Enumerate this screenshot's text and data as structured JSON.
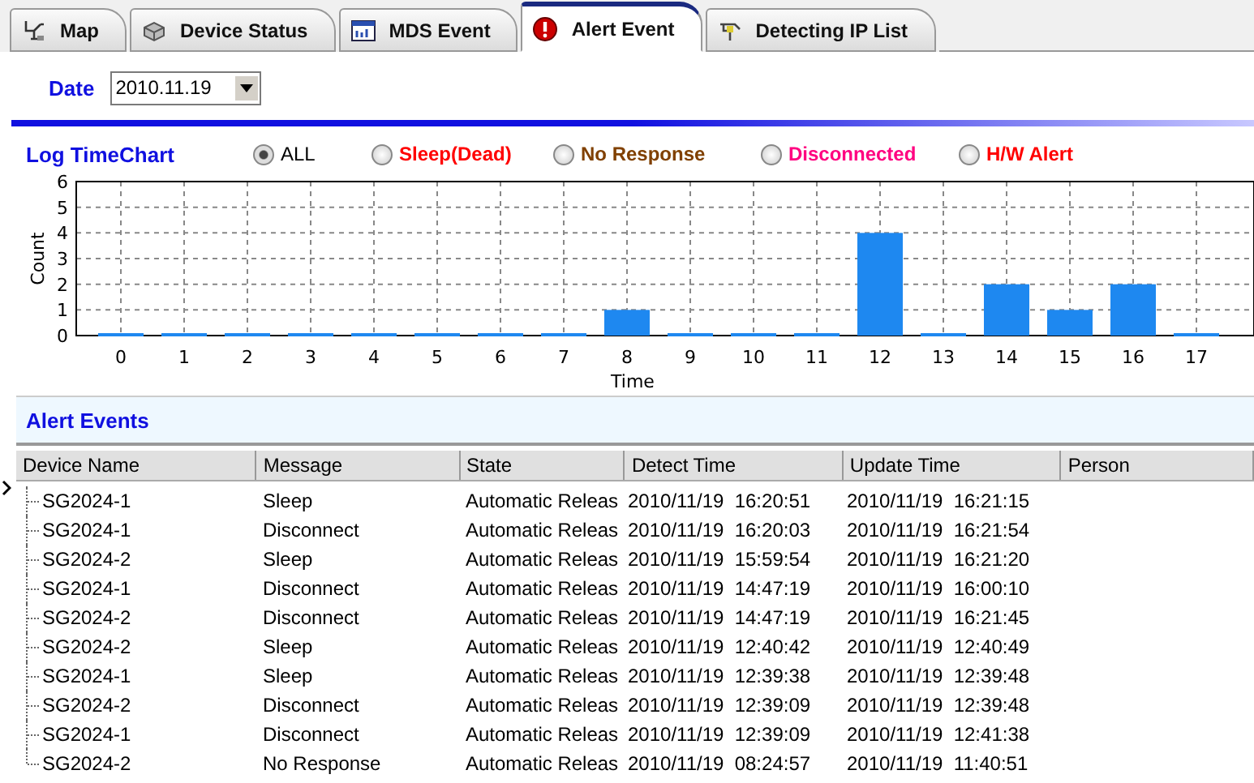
{
  "tabs": [
    {
      "label": "Map",
      "selected": false
    },
    {
      "label": "Device Status",
      "selected": false
    },
    {
      "label": "MDS Event",
      "selected": false
    },
    {
      "label": "Alert Event",
      "selected": true
    },
    {
      "label": "Detecting IP List",
      "selected": false
    }
  ],
  "date": {
    "label": "Date",
    "value": "2010.11.19"
  },
  "timechart": {
    "title": "Log TimeChart",
    "filters": [
      {
        "label": "ALL",
        "color": "#000000",
        "selected": true
      },
      {
        "label": "Sleep(Dead)",
        "color": "#ff0000",
        "selected": false
      },
      {
        "label": "No Response",
        "color": "#804000",
        "selected": false
      },
      {
        "label": "Disconnected",
        "color": "#ff0080",
        "selected": false
      },
      {
        "label": "H/W Alert",
        "color": "#ff0000",
        "selected": false
      }
    ],
    "chart_data": {
      "type": "bar",
      "xlabel": "Time",
      "ylabel": "Count",
      "categories": [
        "0",
        "1",
        "2",
        "3",
        "4",
        "5",
        "6",
        "7",
        "8",
        "9",
        "10",
        "11",
        "12",
        "13",
        "14",
        "15",
        "16",
        "17"
      ],
      "values": [
        0,
        0,
        0,
        0,
        0,
        0,
        0,
        0,
        1,
        0,
        0,
        0,
        4,
        0,
        2,
        1,
        2,
        0
      ],
      "ylim": [
        0,
        6
      ],
      "yticks": [
        0,
        1,
        2,
        3,
        4,
        5,
        6
      ],
      "grid": true
    }
  },
  "alert_events": {
    "title": "Alert Events",
    "columns": [
      "Device Name",
      "Message",
      "State",
      "Detect Time",
      "Update Time",
      "Person"
    ],
    "rows": [
      [
        "SG2024-1",
        "Sleep",
        "Automatic Releas",
        "2010/11/19  16:20:51",
        "2010/11/19  16:21:15"
      ],
      [
        "SG2024-1",
        "Disconnect",
        "Automatic Releas",
        "2010/11/19  16:20:03",
        "2010/11/19  16:21:54"
      ],
      [
        "SG2024-2",
        "Sleep",
        "Automatic Releas",
        "2010/11/19  15:59:54",
        "2010/11/19  16:21:20"
      ],
      [
        "SG2024-1",
        "Disconnect",
        "Automatic Releas",
        "2010/11/19  14:47:19",
        "2010/11/19  16:00:10"
      ],
      [
        "SG2024-2",
        "Disconnect",
        "Automatic Releas",
        "2010/11/19  14:47:19",
        "2010/11/19  16:21:45"
      ],
      [
        "SG2024-2",
        "Sleep",
        "Automatic Releas",
        "2010/11/19  12:40:42",
        "2010/11/19  12:40:49"
      ],
      [
        "SG2024-1",
        "Sleep",
        "Automatic Releas",
        "2010/11/19  12:39:38",
        "2010/11/19  12:39:48"
      ],
      [
        "SG2024-2",
        "Disconnect",
        "Automatic Releas",
        "2010/11/19  12:39:09",
        "2010/11/19  12:39:48"
      ],
      [
        "SG2024-1",
        "Disconnect",
        "Automatic Releas",
        "2010/11/19  12:39:09",
        "2010/11/19  12:41:38"
      ],
      [
        "SG2024-2",
        "No Response",
        "Automatic Releas",
        "2010/11/19  08:24:57",
        "2010/11/19  11:40:51"
      ]
    ]
  }
}
